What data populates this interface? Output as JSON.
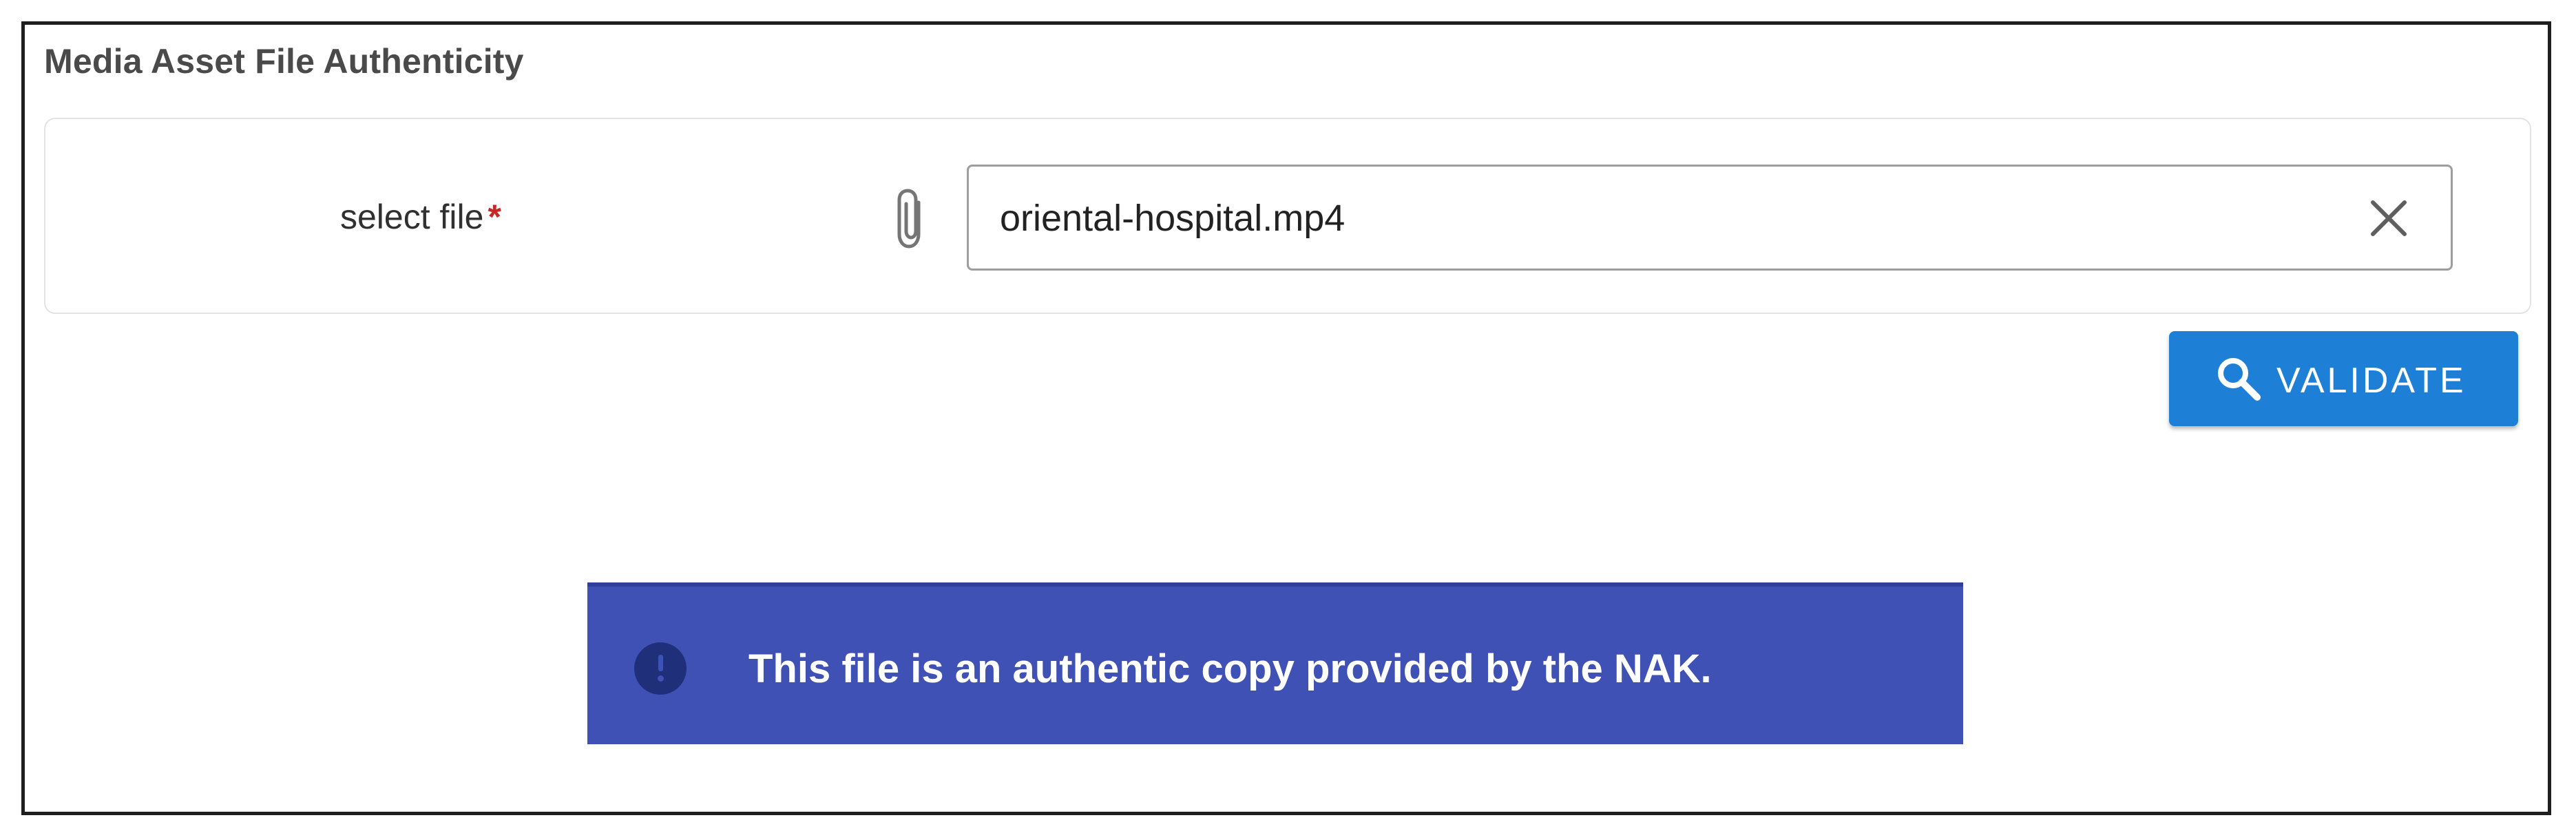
{
  "panel": {
    "title": "Media Asset File Authenticity"
  },
  "form": {
    "select_file_label": "select file",
    "required_marker": "*",
    "file_value": "oriental-hospital.mp4",
    "attach_icon": "paperclip-icon",
    "clear_icon": "close-icon"
  },
  "actions": {
    "validate_label": "VALIDATE",
    "validate_icon": "search-icon"
  },
  "alert": {
    "message": "This file is an authentic copy provided by the NAK.",
    "icon": "info-icon"
  },
  "colors": {
    "primary_button": "#1e7fd6",
    "alert_background": "#3f51b5",
    "required_marker": "#c62828"
  }
}
